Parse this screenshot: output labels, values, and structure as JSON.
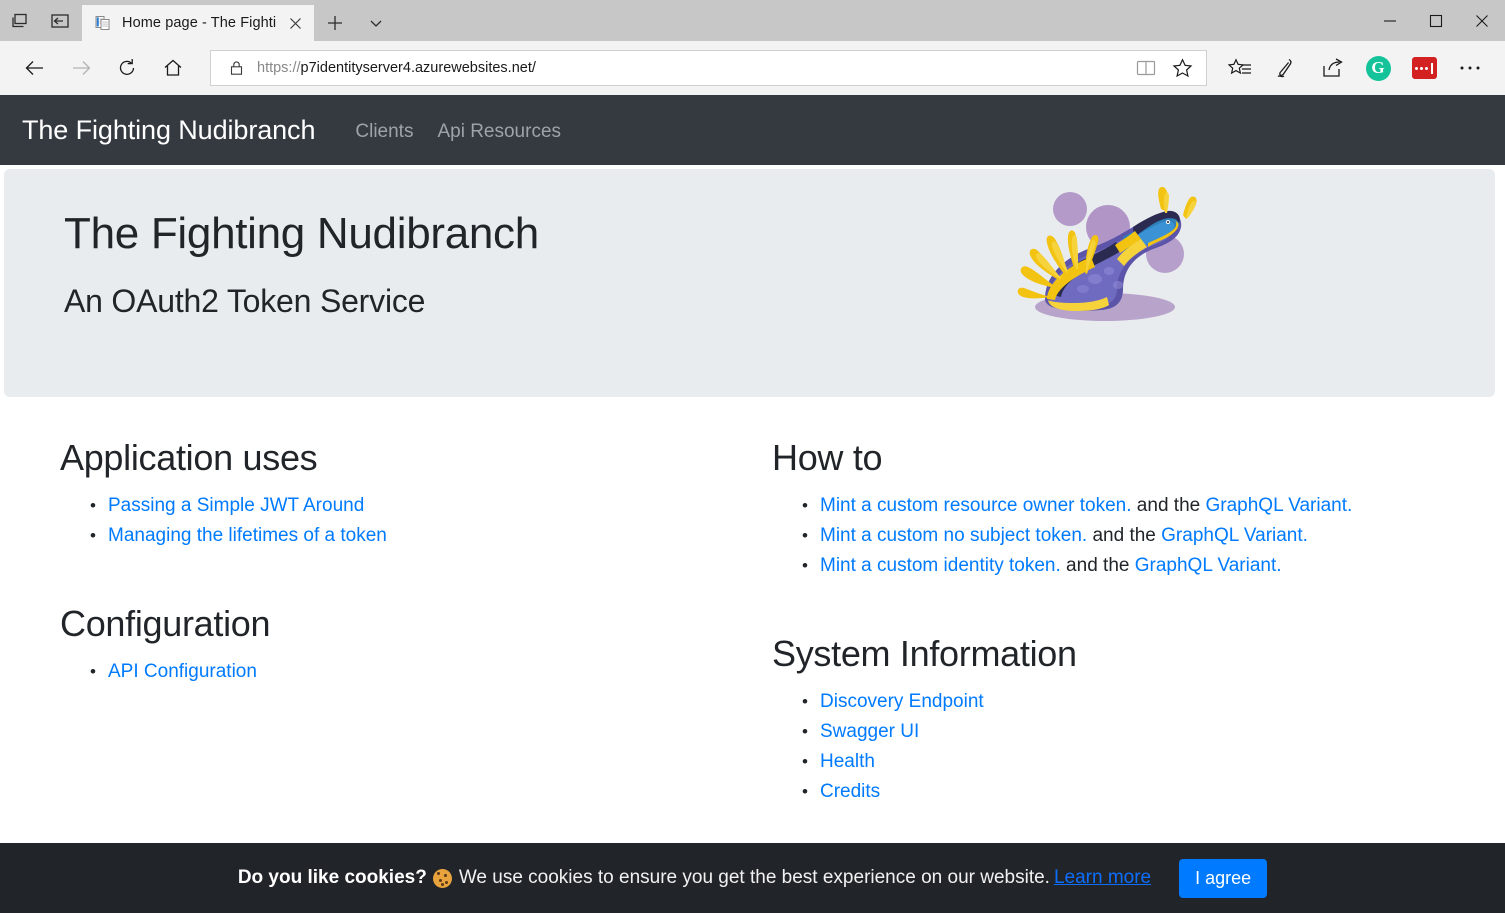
{
  "browser": {
    "tab": {
      "title": "Home page - The Fighti",
      "favicon_icon": "document-page-icon"
    },
    "new_tab_label": "+",
    "tab_menu_icon": "chevron-down-icon",
    "left_buttons": [
      {
        "name": "tab-preview-icon",
        "label": ""
      },
      {
        "name": "set-aside-tabs-icon",
        "label": ""
      }
    ],
    "window_controls": {
      "minimize": "minimize-icon",
      "maximize": "maximize-icon",
      "close": "close-icon"
    },
    "toolbar": {
      "back_icon": "back-arrow-icon",
      "forward_icon": "forward-arrow-icon",
      "refresh_icon": "refresh-icon",
      "home_icon": "home-icon",
      "lock_icon": "lock-icon",
      "url_scheme": "https://",
      "url_host_path": "p7identityserver4.azurewebsites.net/",
      "reading_view_icon": "reading-view-icon",
      "favorite_icon": "star-icon",
      "favorites_hub_icon": "favorites-list-icon",
      "web_notes_icon": "pen-icon",
      "share_icon": "share-icon",
      "grammarly_icon": "grammarly-icon",
      "grammarly_letter": "G",
      "extension_icon": "red-extension-icon",
      "settings_icon": "more-ellipsis-icon"
    }
  },
  "site": {
    "navbar": {
      "brand": "The Fighting Nudibranch",
      "links": [
        {
          "label": "Clients",
          "name": "nav-link-clients"
        },
        {
          "label": "Api Resources",
          "name": "nav-link-api-resources"
        }
      ]
    },
    "jumbotron": {
      "title": "The Fighting Nudibranch",
      "subtitle": "An OAuth2 Token Service",
      "image_name": "nudibranch-illustration"
    },
    "sections": {
      "application_uses": {
        "heading": "Application uses",
        "items": [
          {
            "link": "Passing a Simple JWT Around"
          },
          {
            "link": "Managing the lifetimes of a token"
          }
        ]
      },
      "configuration": {
        "heading": "Configuration",
        "items": [
          {
            "link": "API Configuration"
          }
        ]
      },
      "how_to": {
        "heading": "How to",
        "items": [
          {
            "link": "Mint a custom resource owner token.",
            "mid": " and the ",
            "link2": "GraphQL Variant."
          },
          {
            "link": "Mint a custom no subject token.",
            "mid": " and the ",
            "link2": "GraphQL Variant."
          },
          {
            "link": "Mint a custom identity token.",
            "mid": " and the ",
            "link2": "GraphQL Variant."
          }
        ]
      },
      "system_information": {
        "heading": "System Information",
        "items": [
          {
            "link": "Discovery Endpoint"
          },
          {
            "link": "Swagger UI"
          },
          {
            "link": "Health"
          },
          {
            "link": "Credits"
          }
        ]
      }
    },
    "cookie_banner": {
      "bold_text": "Do you like cookies?",
      "emoji_name": "cookie-emoji",
      "message": "We use cookies to ensure you get the best experience on our website.",
      "learn_more": "Learn more",
      "agree_button": "I agree"
    }
  },
  "colors": {
    "navbar_bg": "#343a40",
    "jumbotron_bg": "#e9ecef",
    "link_blue": "#007bff",
    "cookie_bg": "#212529",
    "grammarly_green": "#15c39a",
    "extension_red": "#d32020"
  }
}
